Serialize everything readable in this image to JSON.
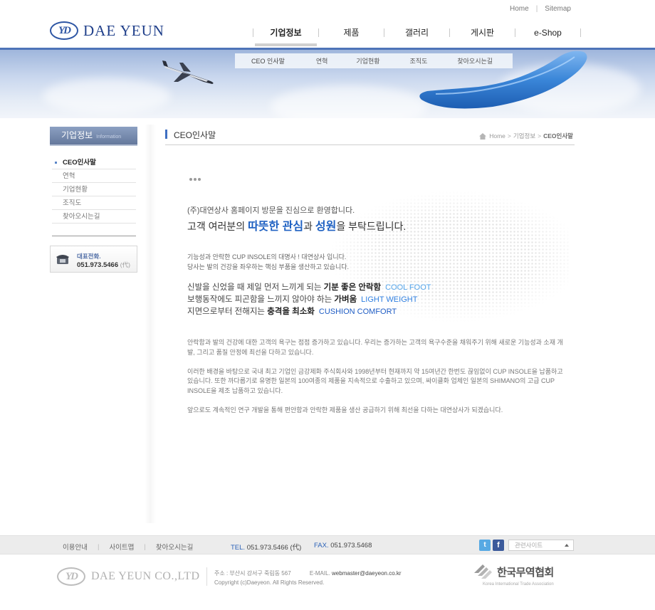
{
  "top_links": {
    "home": "Home",
    "sitemap": "Sitemap"
  },
  "logo": {
    "mark": "YD",
    "text": "DAE YEUN"
  },
  "gnb": [
    {
      "label": "기업정보"
    },
    {
      "label": "제품"
    },
    {
      "label": "갤러리"
    },
    {
      "label": "게시판"
    },
    {
      "label": "e-Shop"
    }
  ],
  "subnav": [
    {
      "label": "CEO 인사말"
    },
    {
      "label": "연혁"
    },
    {
      "label": "기업현황"
    },
    {
      "label": "조직도"
    },
    {
      "label": "찾아오시는길"
    }
  ],
  "sidebar": {
    "title": "기업정보",
    "title_en": "Information",
    "items": [
      {
        "label": "CEO인사말"
      },
      {
        "label": "연혁"
      },
      {
        "label": "기업현황"
      },
      {
        "label": "조직도"
      },
      {
        "label": "찾아오시는길"
      }
    ],
    "tel_label": "대표전화.",
    "tel_number": "051.973.5466",
    "tel_sub": "(代)"
  },
  "content": {
    "title": "CEO인사말",
    "breadcrumb": {
      "home": "Home",
      "section": "기업정보",
      "current": "CEO인사말"
    },
    "greeting_line1": "(주)대연상사 홈페이지 방문을 진심으로 환영합니다.",
    "greeting_line2": {
      "p1": "고객 여러분의 ",
      "h1": "따뜻한 관심",
      "p2": "과 ",
      "h2": "성원",
      "p3": "을 부탁드립니다."
    },
    "intro_line1": "기능성과 안락한 CUP INSOLE의 대명사 ! 대연상사 입니다.",
    "intro_line2": "당사는 발의 건강을 좌우하는 핵심 부품을 생산하고 있습니다.",
    "features": [
      {
        "text": "신발을 신었을 때 제일 먼저 느끼게 되는 ",
        "bold": "기분 좋은 안락함",
        "en": "COOL FOOT"
      },
      {
        "text": "보행동작에도 피곤함을 느끼지 않아야 하는 ",
        "bold": "가벼움",
        "en": "LIGHT WEIGHT"
      },
      {
        "text": "지면으로부터 전해지는 ",
        "bold": "충격을 최소화",
        "en": "CUSHION COMFORT"
      }
    ],
    "paragraphs": [
      "안락함과 발의 건강에 대한 고객의 욕구는 점점 증가하고 있습니다. 우리는 증가하는 고객의 욕구수준을 채워주기 위해 새로운 기능성과 소재 개발, 그리고 품질 안정에 최선을 다하고 있습니다.",
      "이러한 배경을 바탕으로 국내 최고 기업인 금강제화 주식회사와 1998년부터 현재까지 약 15여년간 한번도 끊임없이 CUP INSOLE을 납품하고 있습니다. 또한 까다롭기로 유명한 일본의 100여종의 제품을 지속적으로 수출하고 있으며, 싸이클화 업체인 일본의 SHIMANO의 고급 CUP INSOLE을 제조 납품하고 있습니다.",
      "앞으로도 계속적인 연구 개발을 통해 편안함과 안락한 제품을 생산 공급하기 위해 최선을 다하는 대연상사가 되겠습니다."
    ]
  },
  "footer": {
    "links": [
      {
        "label": "이용안내"
      },
      {
        "label": "사이트맵"
      },
      {
        "label": "찾아오시는길"
      }
    ],
    "tel_label": "TEL.",
    "tel": "051.973.5466 (代)",
    "fax_label": "FAX.",
    "fax": "051.973.5468",
    "related_site": "관련사이트",
    "logo_mark": "YD",
    "logo_text": "DAE YEUN CO.,LTD",
    "address": "주소 : 부산시 강서구 죽림동 567",
    "email_label": "E-MAIL.",
    "email": "webmaster@daeyeon.co.kr",
    "copyright": "Copyright (c)Daeyeon. All Rights Reserved.",
    "kita_name": "한국무역협회",
    "kita_sub": "Korea International Trade Association"
  },
  "colors": {
    "brand_blue": "#2e56a4",
    "highlight_blue": "#1f61c2",
    "banner_top": "#4e74b8"
  }
}
